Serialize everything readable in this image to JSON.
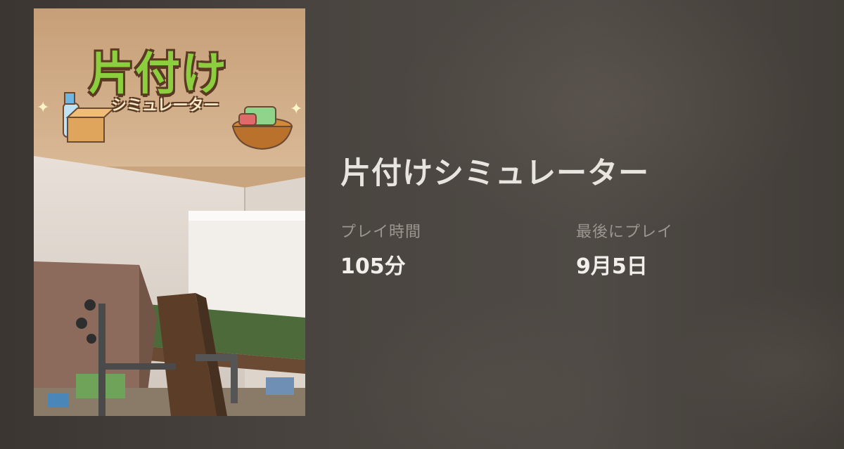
{
  "game": {
    "title": "片付けシミュレーター",
    "cover": {
      "logo_main": "片付け",
      "logo_sub": "シミュレーター"
    }
  },
  "stats": {
    "playtime": {
      "label": "プレイ時間",
      "value": "105分"
    },
    "last_played": {
      "label": "最後にプレイ",
      "value": "9月5日"
    }
  },
  "colors": {
    "background": "#45403b",
    "title_text": "#e8e4e0",
    "label_text": "#9c9691",
    "value_text": "#f1eeeb",
    "logo_green": "#8ccf3e"
  }
}
